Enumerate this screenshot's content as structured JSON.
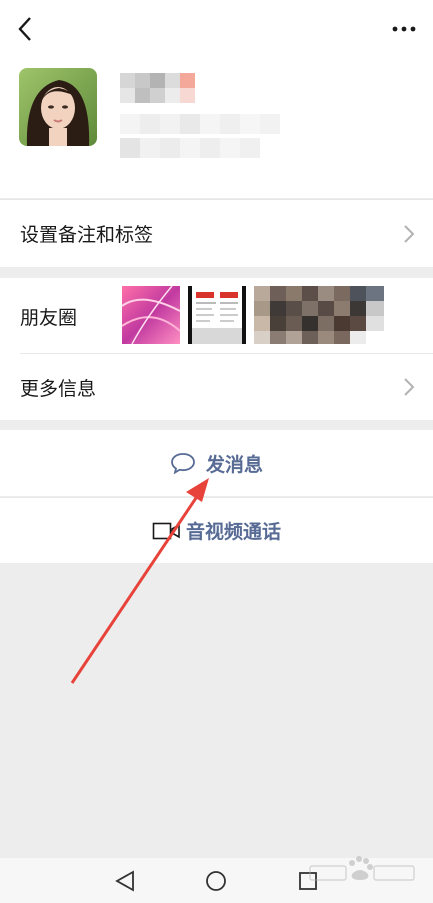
{
  "header": {
    "back_icon": "chevron-left-icon",
    "more_icon": "more-dots-icon"
  },
  "profile": {
    "avatar": "portrait-photo"
  },
  "rows": {
    "remark_label": "设置备注和标签",
    "moments_label": "朋友圈",
    "more_info_label": "更多信息"
  },
  "actions": {
    "message_label": "发消息",
    "message_icon": "chat-bubble-icon",
    "call_label": "音视频通话",
    "call_icon": "video-camera-icon"
  },
  "colors": {
    "accent_link": "#576b95",
    "annotation_arrow": "#e8433a"
  },
  "navbar": {
    "back_icon": "triangle-back-icon",
    "home_icon": "circle-home-icon",
    "recents_icon": "square-recents-icon"
  }
}
